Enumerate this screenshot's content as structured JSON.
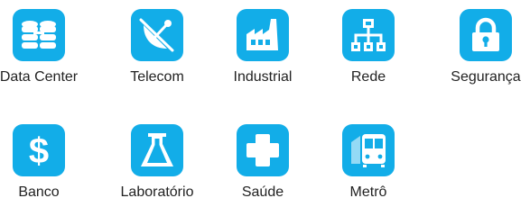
{
  "colors": {
    "tile": "#12ADE8",
    "glyph": "#FFFFFF",
    "text": "#222222"
  },
  "items": [
    {
      "label": "Data Center",
      "icon": "database-icon"
    },
    {
      "label": "Telecom",
      "icon": "satellite-dish-icon"
    },
    {
      "label": "Industrial",
      "icon": "factory-icon"
    },
    {
      "label": "Rede",
      "icon": "network-icon"
    },
    {
      "label": "Segurança",
      "icon": "padlock-icon"
    },
    {
      "label": "Banco",
      "icon": "dollar-icon"
    },
    {
      "label": "Laboratório",
      "icon": "flask-icon"
    },
    {
      "label": "Saúde",
      "icon": "medical-cross-icon"
    },
    {
      "label": "Metrô",
      "icon": "train-icon"
    }
  ]
}
